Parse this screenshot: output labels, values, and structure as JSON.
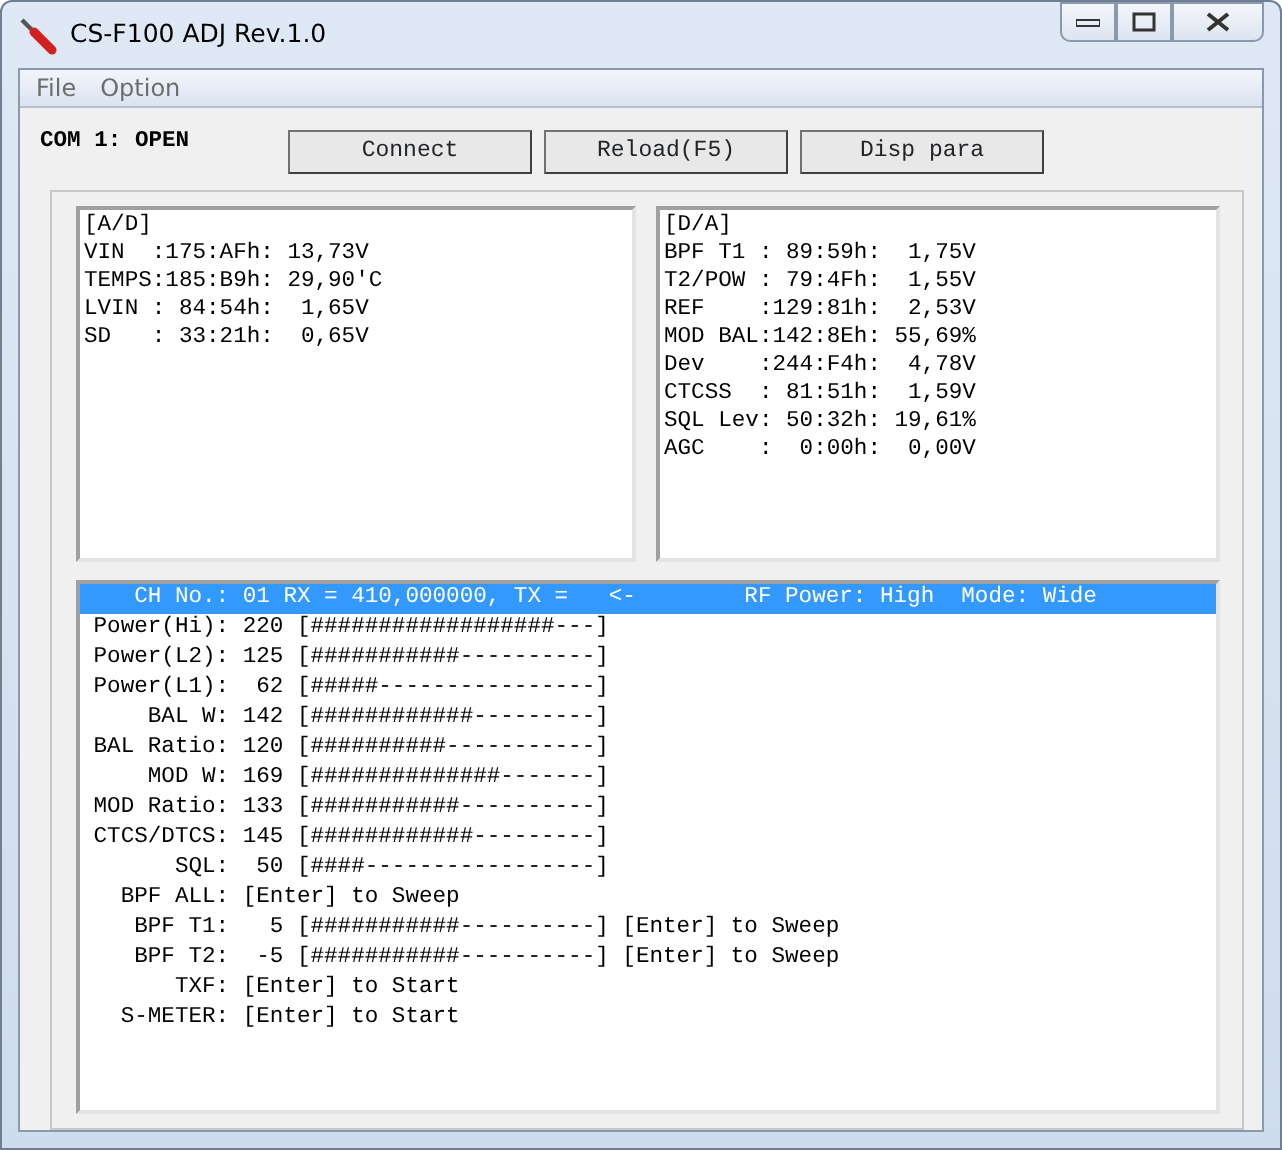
{
  "window": {
    "title": "CS-F100 ADJ Rev.1.0"
  },
  "menu": [
    "File",
    "Option"
  ],
  "status": "COM 1: OPEN",
  "buttons": [
    "Connect",
    "Reload(F5)",
    "Disp para"
  ],
  "ad_panel": [
    "[A/D]",
    "VIN  :175:AFh: 13,73V",
    "TEMPS:185:B9h: 29,90'C",
    "LVIN : 84:54h:  1,65V",
    "SD   : 33:21h:  0,65V"
  ],
  "da_panel": [
    "[D/A]",
    "BPF T1 : 89:59h:  1,75V",
    "T2/POW : 79:4Fh:  1,55V",
    "REF    :129:81h:  2,53V",
    "MOD BAL:142:8Eh: 55,69%",
    "Dev    :244:F4h:  4,78V",
    "CTCSS  : 81:51h:  1,59V",
    "SQL Lev: 50:32h: 19,61%",
    "AGC    :  0:00h:  0,00V"
  ],
  "params": [
    {
      "text": "    CH No.: 01 RX = 410,000000, TX =   <-        RF Power: High  Mode: Wide",
      "selected": true
    },
    {
      "text": " Power(Hi): 220 [##################---]",
      "selected": false
    },
    {
      "text": " Power(L2): 125 [###########----------]",
      "selected": false
    },
    {
      "text": " Power(L1):  62 [#####----------------]",
      "selected": false
    },
    {
      "text": "     BAL W: 142 [############---------]",
      "selected": false
    },
    {
      "text": " BAL Ratio: 120 [##########-----------]",
      "selected": false
    },
    {
      "text": "     MOD W: 169 [##############-------]",
      "selected": false
    },
    {
      "text": " MOD Ratio: 133 [###########----------]",
      "selected": false
    },
    {
      "text": " CTCS/DTCS: 145 [############---------]",
      "selected": false
    },
    {
      "text": "       SQL:  50 [####-----------------]",
      "selected": false
    },
    {
      "text": "   BPF ALL: [Enter] to Sweep",
      "selected": false
    },
    {
      "text": "    BPF T1:   5 [###########----------] [Enter] to Sweep",
      "selected": false
    },
    {
      "text": "    BPF T2:  -5 [###########----------] [Enter] to Sweep",
      "selected": false
    },
    {
      "text": "       TXF: [Enter] to Start",
      "selected": false
    },
    {
      "text": "   S-METER: [Enter] to Start",
      "selected": false
    }
  ]
}
